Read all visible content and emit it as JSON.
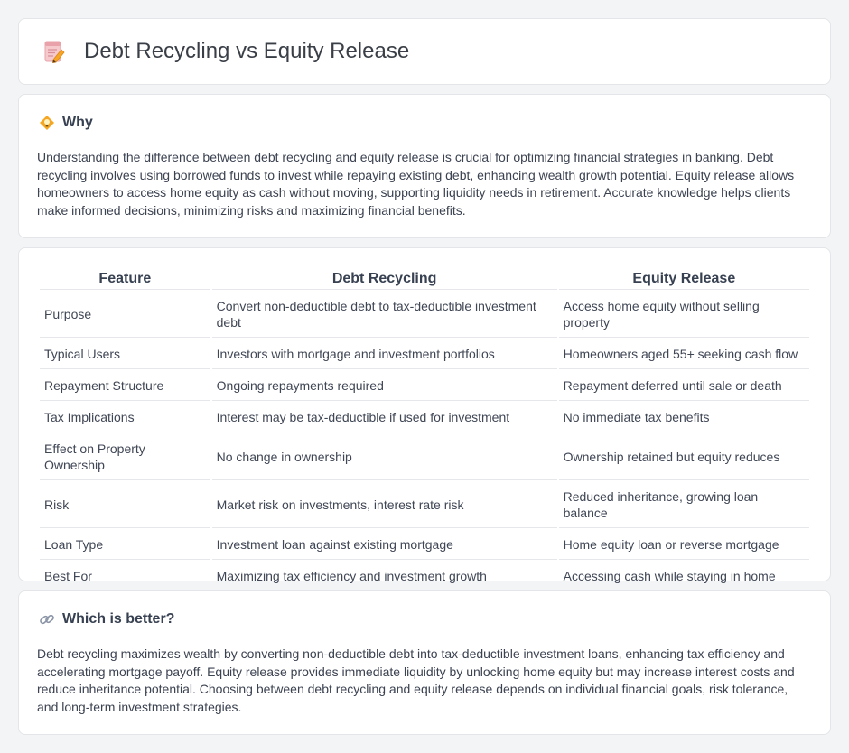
{
  "header": {
    "title": "Debt Recycling vs Equity Release",
    "icon": "document-pencil-icon"
  },
  "why": {
    "icon": "lightbulb-icon",
    "title": "Why",
    "text": "Understanding the difference between debt recycling and equity release is crucial for optimizing financial strategies in banking. Debt recycling involves using borrowed funds to invest while repaying existing debt, enhancing wealth growth potential. Equity release allows homeowners to access home equity as cash without moving, supporting liquidity needs in retirement. Accurate knowledge helps clients make informed decisions, minimizing risks and maximizing financial benefits."
  },
  "table": {
    "headers": [
      "Feature",
      "Debt Recycling",
      "Equity Release"
    ],
    "rows": [
      [
        "Purpose",
        "Convert non-deductible debt to tax-deductible investment debt",
        "Access home equity without selling property"
      ],
      [
        "Typical Users",
        "Investors with mortgage and investment portfolios",
        "Homeowners aged 55+ seeking cash flow"
      ],
      [
        "Repayment Structure",
        "Ongoing repayments required",
        "Repayment deferred until sale or death"
      ],
      [
        "Tax Implications",
        "Interest may be tax-deductible if used for investment",
        "No immediate tax benefits"
      ],
      [
        "Effect on Property Ownership",
        "No change in ownership",
        "Ownership retained but equity reduces"
      ],
      [
        "Risk",
        "Market risk on investments, interest rate risk",
        "Reduced inheritance, growing loan balance"
      ],
      [
        "Loan Type",
        "Investment loan against existing mortgage",
        "Home equity loan or reverse mortgage"
      ],
      [
        "Best For",
        "Maximizing tax efficiency and investment growth",
        "Accessing cash while staying in home"
      ]
    ]
  },
  "better": {
    "icon": "link-icon",
    "title": "Which is better?",
    "text": "Debt recycling maximizes wealth by converting non-deductible debt into tax-deductible investment loans, enhancing tax efficiency and accelerating mortgage payoff. Equity release provides immediate liquidity by unlocking home equity but may increase interest costs and reduce inheritance potential. Choosing between debt recycling and equity release depends on individual financial goals, risk tolerance, and long-term investment strategies."
  },
  "colors": {
    "accent_orange": "#f59e0b",
    "icon_pink": "#f4a0a8",
    "background": "#f3f4f6"
  }
}
